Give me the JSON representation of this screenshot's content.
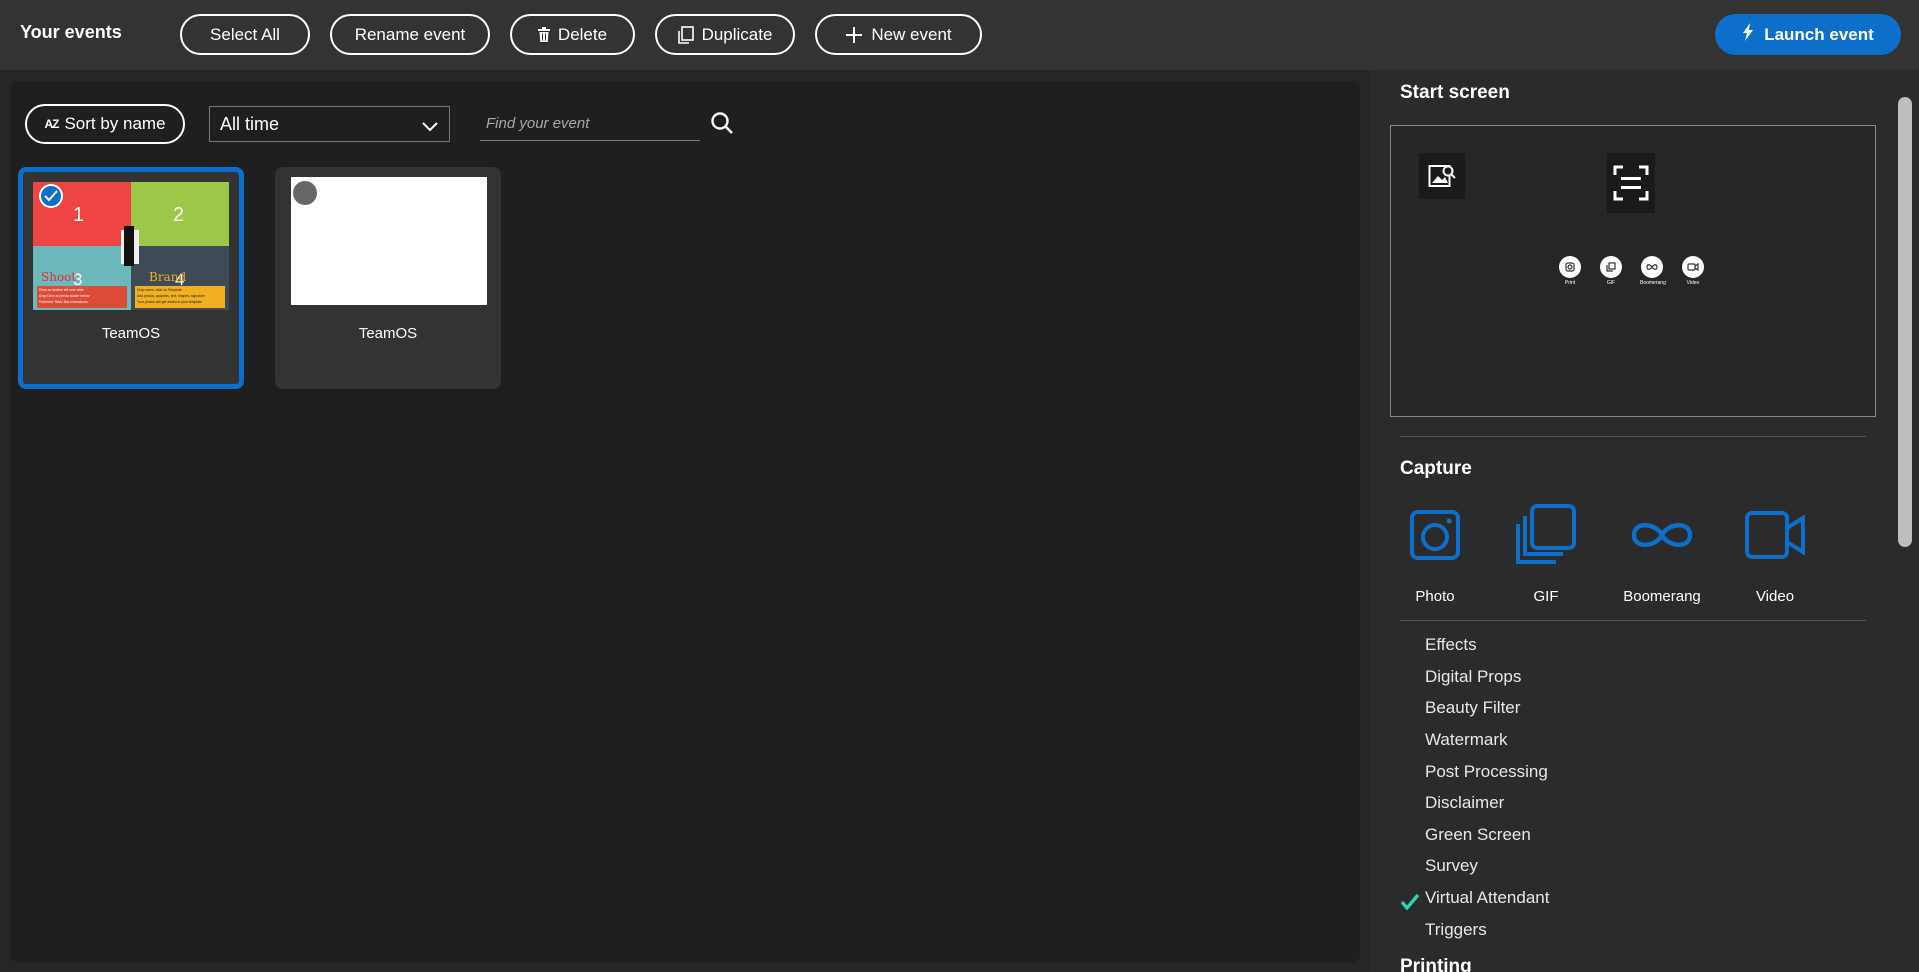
{
  "header": {
    "title": "Your events",
    "select_all": "Select All",
    "rename": "Rename event",
    "delete": "Delete",
    "duplicate": "Duplicate",
    "new_event": "New event",
    "launch": "Launch event"
  },
  "filters": {
    "sort_label": "Sort by name",
    "sort_icon_text": "AZ",
    "time_filter": "All time",
    "search_placeholder": "Find your event"
  },
  "events": [
    {
      "name": "TeamOS",
      "selected": true,
      "thumb": {
        "q1": "1",
        "q2": "2",
        "q3": "3",
        "q4": "4",
        "shoot": "Shoot",
        "brand": "Brand",
        "shoot_lines": [
          "Pose as andere left over wide",
          "Drop Gem or previa sticker below",
          "Preferred 'Stick' Box instructions"
        ],
        "brand_lines": [
          "Drop name, click on Template",
          "Add photos, graphics, text, shapes, signature",
          "Your photos will get added to your template"
        ]
      }
    },
    {
      "name": "TeamOS",
      "selected": false
    }
  ],
  "right_panel": {
    "start_screen_title": "Start screen",
    "preview_options": [
      "Print",
      "GIF",
      "Boomerang",
      "Video"
    ],
    "capture_title": "Capture",
    "capture_options": [
      "Photo",
      "GIF",
      "Boomerang",
      "Video"
    ],
    "features": [
      {
        "label": "Effects",
        "checked": false
      },
      {
        "label": "Digital Props",
        "checked": false
      },
      {
        "label": "Beauty Filter",
        "checked": false
      },
      {
        "label": "Watermark",
        "checked": false
      },
      {
        "label": "Post Processing",
        "checked": false
      },
      {
        "label": "Disclaimer",
        "checked": false
      },
      {
        "label": "Green Screen",
        "checked": false
      },
      {
        "label": "Survey",
        "checked": false
      },
      {
        "label": "Virtual Attendant",
        "checked": true
      },
      {
        "label": "Triggers",
        "checked": false
      }
    ],
    "printing_title": "Printing"
  },
  "colors": {
    "accent": "#0d6fc9",
    "check": "#2fd0b0",
    "background": "#262626",
    "panel": "#1f1f1f"
  }
}
